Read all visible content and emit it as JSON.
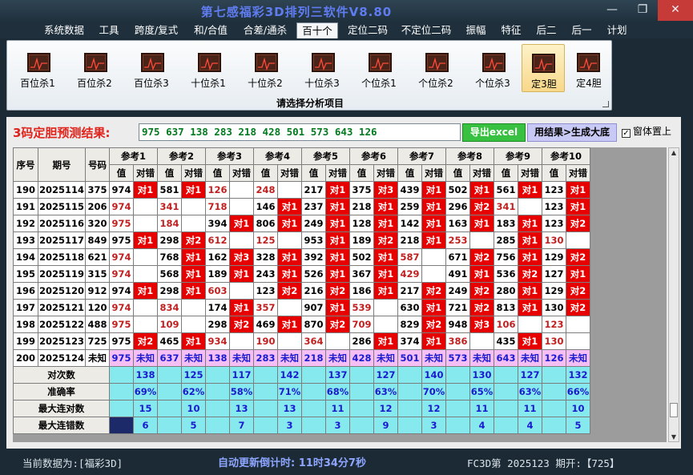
{
  "window": {
    "title": "第七感福彩3D排列三软件V8.80",
    "minimize_glyph": "—",
    "restore_glyph": "❐",
    "close_glyph": "✕"
  },
  "menu": {
    "items": [
      "系统数据",
      "工具",
      "跨度/复式",
      "和/合值",
      "合差/通杀",
      "百十个",
      "定位二码",
      "不定位二码",
      "振幅",
      "特征",
      "后二",
      "后一",
      "计划"
    ],
    "active": "百十个"
  },
  "ribbon": {
    "buttons": [
      "百位杀1",
      "百位杀2",
      "百位杀3",
      "十位杀1",
      "十位杀2",
      "十位杀3",
      "个位杀1",
      "个位杀2",
      "个位杀3",
      "定3胆",
      "定4胆"
    ],
    "active": "定3胆",
    "caption": "请选择分析项目"
  },
  "prediction": {
    "label": "3码定胆预测结果:",
    "value": "975 637 138 283 218 428 501 573 643 126",
    "export_button": "导出excel",
    "generate_button": "用结果>生成大底",
    "topmost_label": "窗体置上",
    "topmost_checked": true,
    "check_glyph": "✓"
  },
  "table": {
    "headers": {
      "seq": "序号",
      "issue": "期号",
      "number": "号码",
      "value": "值",
      "result": "对错"
    },
    "refs": [
      "参考1",
      "参考2",
      "参考3",
      "参考4",
      "参考5",
      "参考6",
      "参考7",
      "参考8",
      "参考9",
      "参考10"
    ],
    "rows": [
      {
        "seq": "190",
        "issue": "2025114",
        "num": "375",
        "cells": [
          [
            "974",
            "对1"
          ],
          [
            "581",
            "对1"
          ],
          [
            "126",
            ""
          ],
          [
            "248",
            ""
          ],
          [
            "217",
            "对1"
          ],
          [
            "375",
            "对3"
          ],
          [
            "439",
            "对1"
          ],
          [
            "502",
            "对1"
          ],
          [
            "561",
            "对1"
          ],
          [
            "123",
            "对1"
          ]
        ]
      },
      {
        "seq": "191",
        "issue": "2025115",
        "num": "206",
        "cells": [
          [
            "974",
            ""
          ],
          [
            "341",
            ""
          ],
          [
            "718",
            ""
          ],
          [
            "146",
            "对1"
          ],
          [
            "237",
            "对1"
          ],
          [
            "218",
            "对1"
          ],
          [
            "259",
            "对1"
          ],
          [
            "296",
            "对2"
          ],
          [
            "341",
            ""
          ],
          [
            "123",
            "对1"
          ]
        ]
      },
      {
        "seq": "192",
        "issue": "2025116",
        "num": "320",
        "cells": [
          [
            "975",
            ""
          ],
          [
            "184",
            ""
          ],
          [
            "394",
            "对1"
          ],
          [
            "806",
            "对1"
          ],
          [
            "249",
            "对1"
          ],
          [
            "128",
            "对1"
          ],
          [
            "142",
            "对1"
          ],
          [
            "163",
            "对1"
          ],
          [
            "183",
            "对1"
          ],
          [
            "123",
            "对2"
          ]
        ]
      },
      {
        "seq": "193",
        "issue": "2025117",
        "num": "849",
        "cells": [
          [
            "975",
            "对1"
          ],
          [
            "298",
            "对2"
          ],
          [
            "612",
            ""
          ],
          [
            "125",
            ""
          ],
          [
            "953",
            "对1"
          ],
          [
            "189",
            "对2"
          ],
          [
            "218",
            "对1"
          ],
          [
            "253",
            ""
          ],
          [
            "285",
            "对1"
          ],
          [
            "130",
            ""
          ]
        ]
      },
      {
        "seq": "194",
        "issue": "2025118",
        "num": "621",
        "cells": [
          [
            "974",
            ""
          ],
          [
            "768",
            "对1"
          ],
          [
            "162",
            "对3"
          ],
          [
            "328",
            "对1"
          ],
          [
            "392",
            "对1"
          ],
          [
            "502",
            "对1"
          ],
          [
            "587",
            ""
          ],
          [
            "671",
            "对2"
          ],
          [
            "756",
            "对1"
          ],
          [
            "129",
            "对2"
          ]
        ]
      },
      {
        "seq": "195",
        "issue": "2025119",
        "num": "315",
        "cells": [
          [
            "974",
            ""
          ],
          [
            "568",
            "对1"
          ],
          [
            "189",
            "对1"
          ],
          [
            "243",
            "对1"
          ],
          [
            "526",
            "对1"
          ],
          [
            "367",
            "对1"
          ],
          [
            "429",
            ""
          ],
          [
            "491",
            "对1"
          ],
          [
            "536",
            "对2"
          ],
          [
            "127",
            "对1"
          ]
        ]
      },
      {
        "seq": "196",
        "issue": "2025120",
        "num": "912",
        "cells": [
          [
            "974",
            "对1"
          ],
          [
            "298",
            "对1"
          ],
          [
            "603",
            ""
          ],
          [
            "123",
            "对2"
          ],
          [
            "216",
            "对2"
          ],
          [
            "186",
            "对1"
          ],
          [
            "217",
            "对2"
          ],
          [
            "249",
            "对2"
          ],
          [
            "280",
            "对1"
          ],
          [
            "129",
            "对2"
          ]
        ]
      },
      {
        "seq": "197",
        "issue": "2025121",
        "num": "120",
        "cells": [
          [
            "974",
            ""
          ],
          [
            "834",
            ""
          ],
          [
            "174",
            "对1"
          ],
          [
            "357",
            ""
          ],
          [
            "907",
            "对1"
          ],
          [
            "539",
            ""
          ],
          [
            "630",
            "对1"
          ],
          [
            "721",
            "对2"
          ],
          [
            "813",
            "对1"
          ],
          [
            "130",
            "对2"
          ]
        ]
      },
      {
        "seq": "198",
        "issue": "2025122",
        "num": "488",
        "cells": [
          [
            "975",
            ""
          ],
          [
            "109",
            ""
          ],
          [
            "298",
            "对2"
          ],
          [
            "469",
            "对1"
          ],
          [
            "870",
            "对2"
          ],
          [
            "709",
            ""
          ],
          [
            "829",
            "对2"
          ],
          [
            "948",
            "对3"
          ],
          [
            "106",
            ""
          ],
          [
            "123",
            ""
          ]
        ]
      },
      {
        "seq": "199",
        "issue": "2025123",
        "num": "725",
        "cells": [
          [
            "975",
            "对2"
          ],
          [
            "465",
            "对1"
          ],
          [
            "934",
            ""
          ],
          [
            "190",
            ""
          ],
          [
            "364",
            ""
          ],
          [
            "286",
            "对1"
          ],
          [
            "374",
            "对1"
          ],
          [
            "386",
            ""
          ],
          [
            "435",
            "对1"
          ],
          [
            "130",
            ""
          ]
        ]
      }
    ],
    "future": {
      "seq": "200",
      "issue": "2025124",
      "num": "未知",
      "values": [
        "975",
        "637",
        "138",
        "283",
        "218",
        "428",
        "501",
        "573",
        "643",
        "126"
      ],
      "result": "未知"
    },
    "stats": [
      {
        "label": "对次数",
        "values": [
          "138",
          "125",
          "117",
          "142",
          "137",
          "127",
          "140",
          "130",
          "127",
          "132"
        ]
      },
      {
        "label": "准确率",
        "values": [
          "69%",
          "62%",
          "58%",
          "71%",
          "68%",
          "63%",
          "70%",
          "65%",
          "63%",
          "66%"
        ]
      },
      {
        "label": "最大连对数",
        "values": [
          "15",
          "10",
          "13",
          "13",
          "11",
          "12",
          "12",
          "11",
          "11",
          "10"
        ]
      },
      {
        "label": "最大连错数",
        "values": [
          "6",
          "5",
          "7",
          "3",
          "3",
          "9",
          "3",
          "4",
          "4",
          "5"
        ]
      }
    ]
  },
  "status": {
    "current_data": "当前数据为:[福彩3D]",
    "countdown": "自动更新倒计时: 11时34分7秒",
    "last_draw": "FC3D第 2025123 期开:【725】"
  },
  "colors": {
    "hit": "#e60000",
    "miss_value": "#c01f1f",
    "stat_bg": "#86e9ee",
    "future_bg": "#f5bff5",
    "title": "#5f7cf0"
  }
}
